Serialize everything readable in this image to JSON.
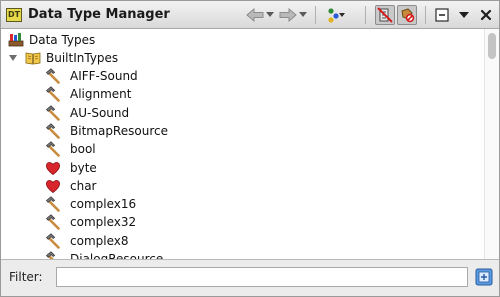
{
  "window": {
    "title": "Data Type Manager",
    "app_icon_text": "DT"
  },
  "toolbar": {
    "buttons": [
      {
        "name": "back-button",
        "icon": "arrow-left-icon"
      },
      {
        "name": "back-dropdown",
        "icon": "chevron-down-icon"
      },
      {
        "name": "forward-button",
        "icon": "arrow-right-icon"
      },
      {
        "name": "forward-dropdown",
        "icon": "chevron-down-icon"
      },
      {
        "name": "archive-options-button",
        "icon": "colored-dots-icon"
      },
      {
        "name": "filter-pointers-toggle",
        "icon": "pointer-filter-icon",
        "pressed": true
      },
      {
        "name": "filter-arrays-toggle",
        "icon": "array-filter-icon",
        "pressed": true
      },
      {
        "name": "collapse-all-button",
        "icon": "collapse-icon"
      },
      {
        "name": "view-menu-button",
        "icon": "triangle-down-icon"
      },
      {
        "name": "close-button",
        "icon": "close-icon"
      }
    ]
  },
  "tree": {
    "root": {
      "label": "Data Types",
      "icon": "data-types-icon"
    },
    "archive": {
      "label": "BuiltInTypes",
      "icon": "book-icon",
      "expanded": true
    },
    "items": [
      {
        "label": "AIFF-Sound",
        "icon": "hammer-icon"
      },
      {
        "label": "Alignment",
        "icon": "hammer-icon"
      },
      {
        "label": "AU-Sound",
        "icon": "hammer-icon"
      },
      {
        "label": "BitmapResource",
        "icon": "hammer-icon"
      },
      {
        "label": "bool",
        "icon": "hammer-icon"
      },
      {
        "label": "byte",
        "icon": "heart-icon"
      },
      {
        "label": "char",
        "icon": "heart-icon"
      },
      {
        "label": "complex16",
        "icon": "hammer-icon"
      },
      {
        "label": "complex32",
        "icon": "hammer-icon"
      },
      {
        "label": "complex8",
        "icon": "hammer-icon"
      },
      {
        "label": "DialogResource",
        "icon": "hammer-icon"
      }
    ]
  },
  "filter": {
    "label": "Filter:",
    "value": "",
    "placeholder": ""
  },
  "colors": {
    "tree_background": "#ffffff",
    "panel_background": "#ececec",
    "heart": "#d8262c",
    "hammer_head": "#7a7a7a",
    "hammer_handle": "#c88a3c"
  }
}
